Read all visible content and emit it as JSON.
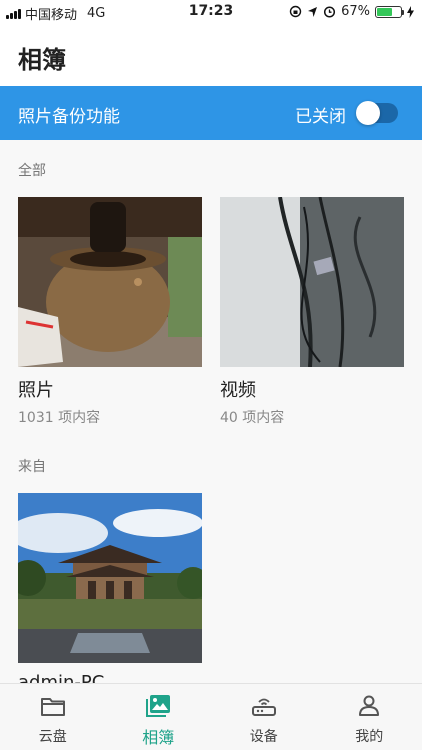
{
  "status_bar": {
    "carrier": "中国移动",
    "network": "4G",
    "time": "17:23",
    "battery_percent": "67%",
    "battery_level": 0.67
  },
  "header": {
    "title": "相簿"
  },
  "backup": {
    "label": "照片备份功能",
    "status": "已关闭",
    "enabled": false
  },
  "sections": {
    "all_label": "全部",
    "from_label": "来自"
  },
  "albums": [
    {
      "name": "照片",
      "count": "1031 项内容"
    },
    {
      "name": "视频",
      "count": "40 项内容"
    }
  ],
  "devices": [
    {
      "name": "admin-PC"
    }
  ],
  "tabs": [
    {
      "label": "云盘",
      "icon": "folder-icon",
      "active": false
    },
    {
      "label": "相簿",
      "icon": "photo-album-icon",
      "active": true
    },
    {
      "label": "设备",
      "icon": "router-icon",
      "active": false
    },
    {
      "label": "我的",
      "icon": "person-icon",
      "active": false
    }
  ],
  "colors": {
    "accent": "#1fa38a",
    "banner": "#2e95e6"
  }
}
